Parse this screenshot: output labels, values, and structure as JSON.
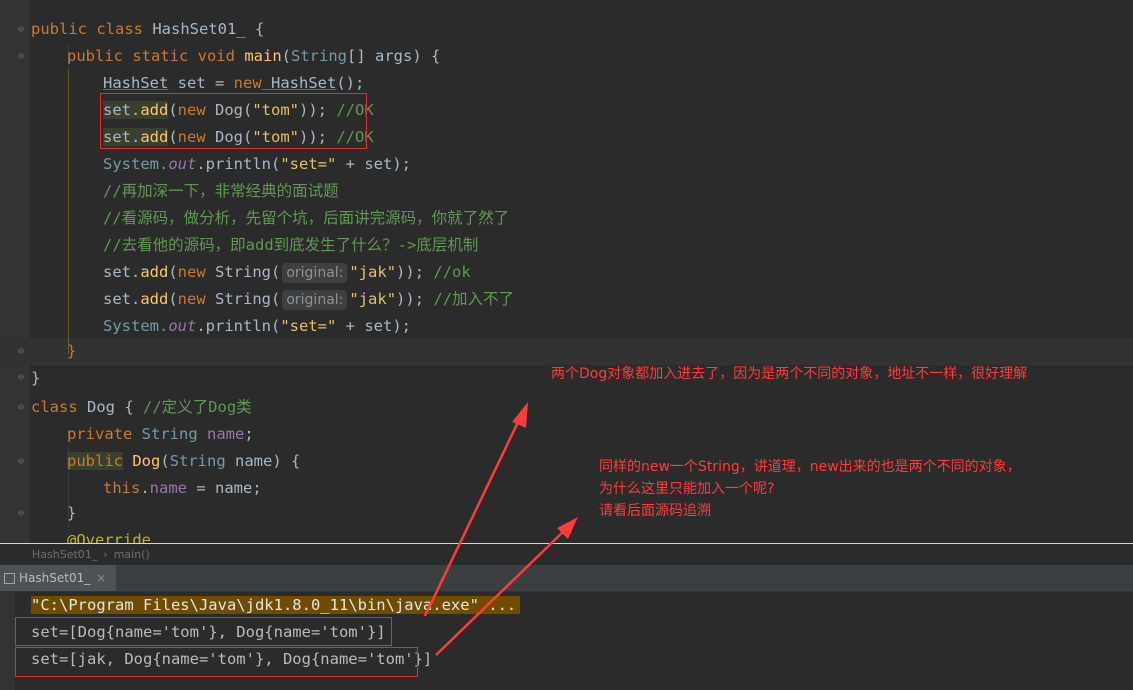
{
  "editor": {
    "lines": {
      "l1": {
        "kw": "public class",
        "cls": "HashSet01_",
        "rest": " {"
      },
      "l2": {
        "kw": "public static void",
        "fn": "main",
        "p1": "(",
        "type": "String",
        "p2": "[] args) {"
      },
      "l3": {
        "t1": "HashSet",
        "t2": " set = ",
        "kw": "new",
        "t3": " HashSet",
        "t4": "();"
      },
      "l4": {
        "a": "set.",
        "b": "add",
        "c": "(",
        "kw": "new",
        "d": " Dog(",
        "s": "\"tom\"",
        "e": ")); ",
        "cm": "//OK"
      },
      "l5": {
        "a": "set.",
        "b": "add",
        "c": "(",
        "kw": "new",
        "d": " Dog(",
        "s": "\"tom\"",
        "e": ")); ",
        "cm": "//OK"
      },
      "l6": {
        "a": "System.",
        "b": "out",
        "c": ".println(",
        "s": "\"set=\"",
        "d": " + set);"
      },
      "l7": {
        "cm": "//再加深一下，非常经典的面试题"
      },
      "l8": {
        "cm": "//看源码，做分析，先留个坑，后面讲完源码，你就了然了"
      },
      "l9": {
        "cm": "//去看他的源码，即add到底发生了什么？->底层机制"
      },
      "l10": {
        "a": "set.",
        "b": "add",
        "c": "(",
        "kw": "new",
        "d": " String(",
        "hint": "original:",
        "s": "\"jak\"",
        "e": ")); ",
        "cm": "//ok"
      },
      "l11": {
        "a": "set.",
        "b": "add",
        "c": "(",
        "kw": "new",
        "d": " String(",
        "hint": "original:",
        "s": "\"jak\"",
        "e": ")); ",
        "cm": "//加入不了"
      },
      "l12": {
        "a": "System.",
        "b": "out",
        "c": ".println(",
        "s": "\"set=\"",
        "d": " + set);"
      },
      "l13": {
        "t": "}"
      },
      "l14": {
        "t": "}"
      },
      "l15": {
        "kw": "class",
        "cls": " Dog",
        "p": " { ",
        "cm": "//定义了Dog类"
      },
      "l16": {
        "kw": "private",
        "type": " String",
        "f": " name",
        "p": ";"
      },
      "l17": {
        "kw": "public",
        "fn": " Dog",
        "p1": "(",
        "type": "String",
        "p2": " name) {"
      },
      "l18": {
        "kw": "this",
        "p1": ".",
        "f": "name",
        "p2": " = name;"
      },
      "l19": {
        "t": "}"
      },
      "l20": {
        "t": "@Override"
      }
    }
  },
  "breadcrumb": {
    "class": "HashSet01_",
    "sep": "›",
    "method": "main()"
  },
  "run": {
    "tab": "HashSet01_",
    "close": "×"
  },
  "console": {
    "cmd": "\"C:\\Program Files\\Java\\jdk1.8.0_11\\bin\\java.exe\" ...",
    "out1": "set=[Dog{name='tom'}, Dog{name='tom'}]",
    "out2": "set=[jak, Dog{name='tom'}, Dog{name='tom'}]"
  },
  "annotations": {
    "note1": "两个Dog对象都加入进去了，因为是两个不同的对象，地址不一样，很好理解",
    "note2_l1": "同样的new一个String，讲道理，new出来的也是两个不同的对象，",
    "note2_l2": "为什么这里只能加入一个呢?",
    "note2_l3": "请看后面源码追溯"
  },
  "colors": {
    "annotation_red": "#ff3b3b",
    "editor_bg": "#2b2b2b",
    "keyword": "#cc7832",
    "string": "#6a8759",
    "comment": "#629755"
  }
}
